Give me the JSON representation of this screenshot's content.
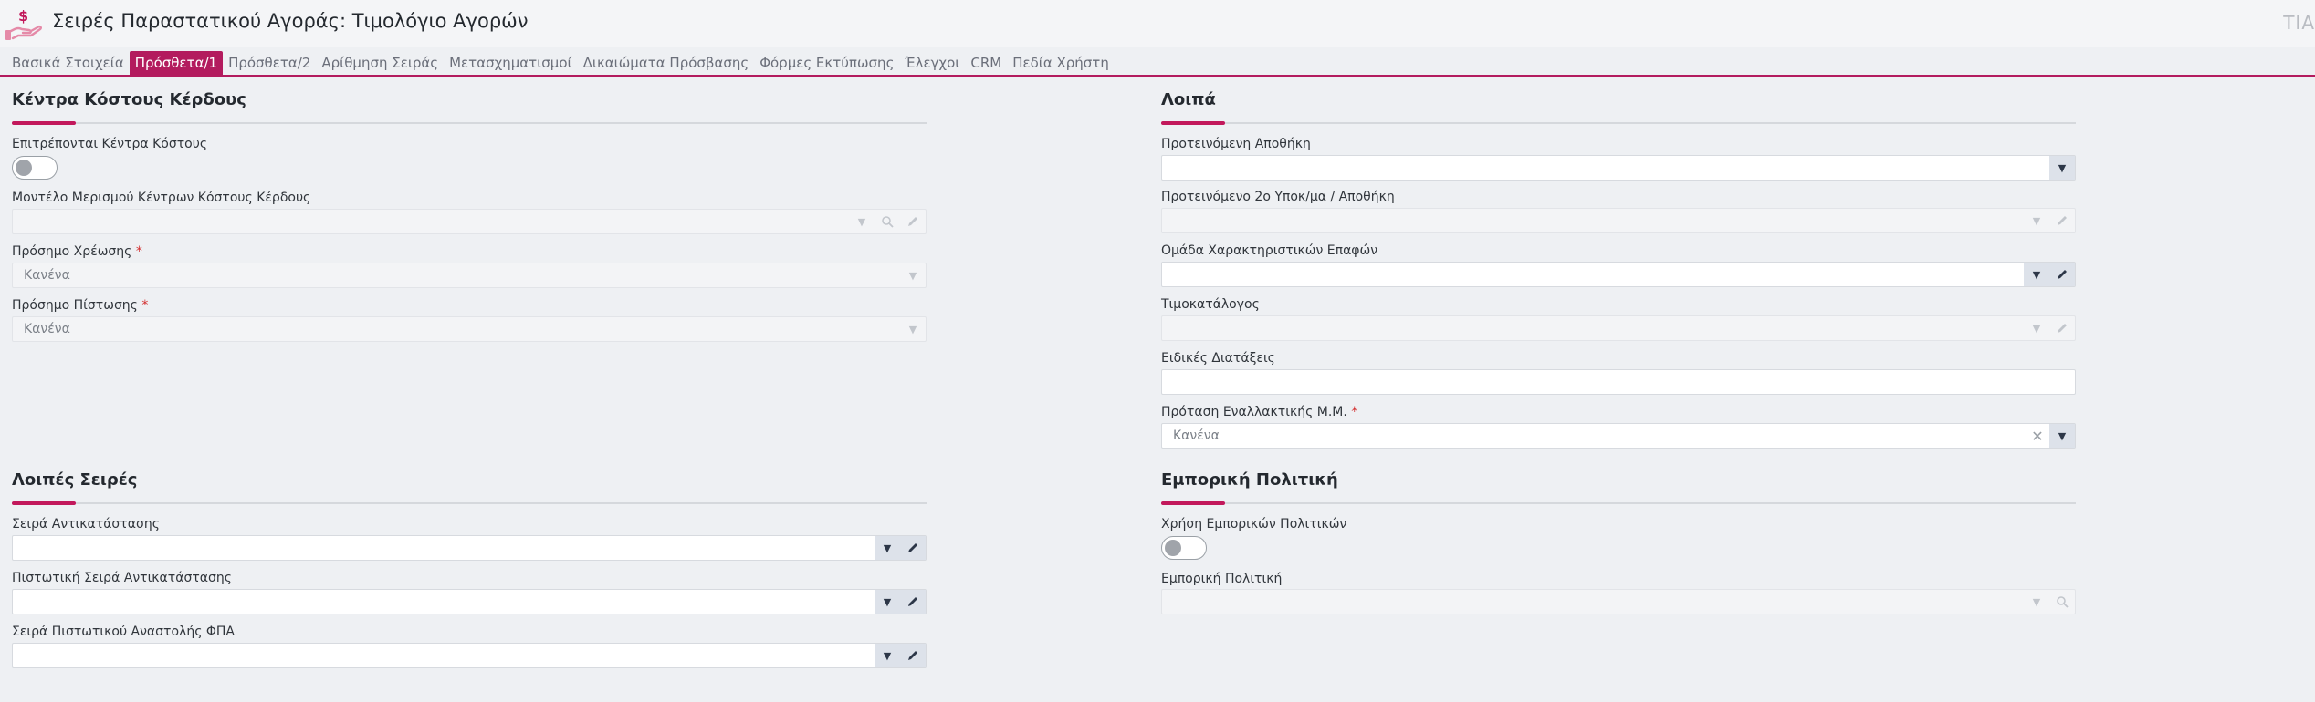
{
  "header": {
    "title": "Σειρές Παραστατικού Αγοράς: Τιμολόγιο Αγορών",
    "logo_icon": "hand-holding-dollar-icon",
    "user_initials": "ΤΙΑ"
  },
  "tabs": [
    {
      "label": "Βασικά Στοιχεία",
      "active": false
    },
    {
      "label": "Πρόσθετα/1",
      "active": true
    },
    {
      "label": "Πρόσθετα/2",
      "active": false
    },
    {
      "label": "Αρίθμηση Σειράς",
      "active": false
    },
    {
      "label": "Μετασχηματισμοί",
      "active": false
    },
    {
      "label": "Δικαιώματα Πρόσβασης",
      "active": false
    },
    {
      "label": "Φόρμες Εκτύπωσης",
      "active": false
    },
    {
      "label": "Έλεγχοι",
      "active": false
    },
    {
      "label": "CRM",
      "active": false
    },
    {
      "label": "Πεδία Χρήστη",
      "active": false
    }
  ],
  "cost_centers": {
    "title": "Κέντρα Κόστους Κέρδους",
    "allow_label": "Επιτρέπονται Κέντρα Κόστους",
    "allow_value": false,
    "model_label": "Μοντέλο Μερισμού Κέντρων Κόστους Κέρδους",
    "model_value": "",
    "debit_sign_label": "Πρόσημο Χρέωσης",
    "debit_sign_value": "Κανένα",
    "credit_sign_label": "Πρόσημο Πίστωσης",
    "credit_sign_value": "Κανένα"
  },
  "other": {
    "title": "Λοιπά",
    "warehouse_label": "Προτεινόμενη Αποθήκη",
    "warehouse_value": "",
    "branch_label": "Προτεινόμενο 2ο Υποκ/μα / Αποθήκη",
    "branch_value": "",
    "contact_group_label": "Ομάδα Χαρακτηριστικών Επαφών",
    "contact_group_value": "",
    "pricelist_label": "Τιμοκατάλογος",
    "pricelist_value": "",
    "special_label": "Ειδικές Διατάξεις",
    "special_value": "",
    "alt_uom_label": "Πρόταση Εναλλακτικής Μ.Μ.",
    "alt_uom_value": "Κανένα"
  },
  "other_series": {
    "title": "Λοιπές Σειρές",
    "replacement_label": "Σειρά Αντικατάστασης",
    "replacement_value": "",
    "credit_replacement_label": "Πιστωτική Σειρά Αντικατάστασης",
    "credit_replacement_value": "",
    "vat_suspension_label": "Σειρά Πιστωτικού Αναστολής ΦΠΑ",
    "vat_suspension_value": ""
  },
  "commercial_policy": {
    "title": "Εμπορική Πολιτική",
    "use_label": "Χρήση Εμπορικών Πολιτικών",
    "use_value": false,
    "policy_label": "Εμπορική Πολιτική",
    "policy_value": ""
  },
  "colors": {
    "accent": "#b31b5e",
    "required": "#d32f2f"
  }
}
